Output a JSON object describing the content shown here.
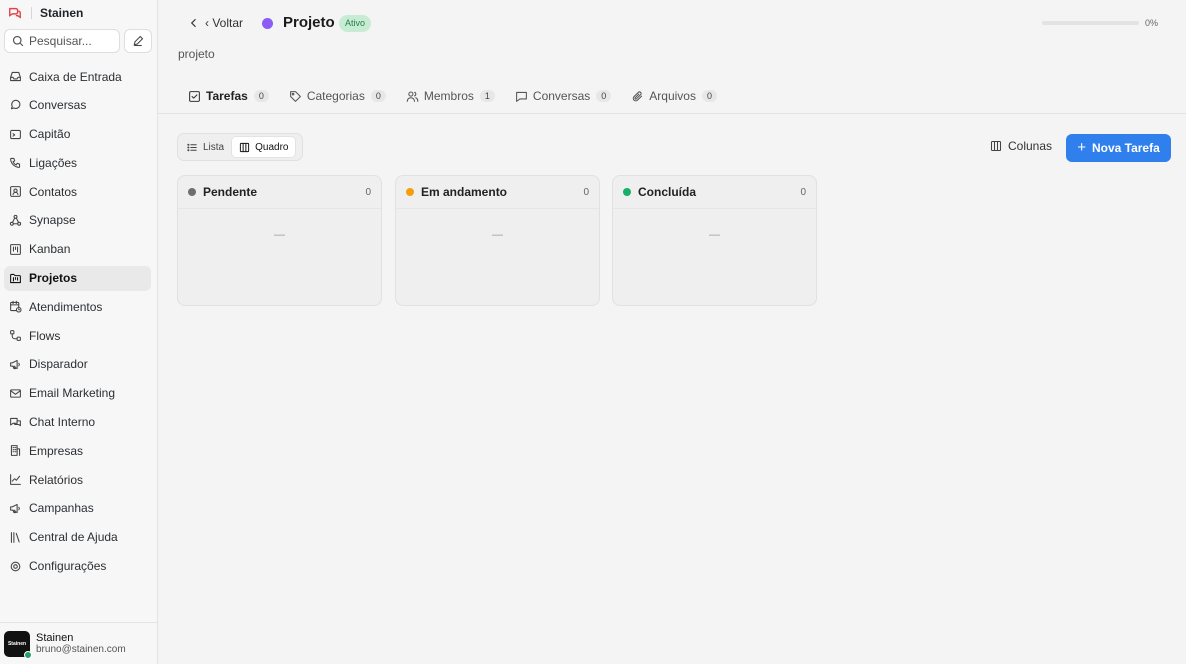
{
  "brand": {
    "name": "Stainen"
  },
  "search": {
    "placeholder": "Pesquisar..."
  },
  "sidebar": {
    "items": [
      {
        "label": "Caixa de Entrada",
        "icon": "inbox-icon"
      },
      {
        "label": "Conversas",
        "icon": "chat-bubble-icon"
      },
      {
        "label": "Capitão",
        "icon": "terminal-icon"
      },
      {
        "label": "Ligações",
        "icon": "phone-icon"
      },
      {
        "label": "Contatos",
        "icon": "contact-card-icon"
      },
      {
        "label": "Synapse",
        "icon": "network-icon"
      },
      {
        "label": "Kanban",
        "icon": "kanban-icon"
      },
      {
        "label": "Projetos",
        "icon": "folder-kanban-icon",
        "active": true
      },
      {
        "label": "Atendimentos",
        "icon": "calendar-clock-icon"
      },
      {
        "label": "Flows",
        "icon": "flow-icon"
      },
      {
        "label": "Disparador",
        "icon": "megaphone-icon"
      },
      {
        "label": "Email Marketing",
        "icon": "mail-icon"
      },
      {
        "label": "Chat Interno",
        "icon": "messages-icon"
      },
      {
        "label": "Empresas",
        "icon": "building-icon"
      },
      {
        "label": "Relatórios",
        "icon": "chart-line-icon"
      },
      {
        "label": "Campanhas",
        "icon": "megaphone-icon"
      },
      {
        "label": "Central de Ajuda",
        "icon": "library-icon"
      },
      {
        "label": "Configurações",
        "icon": "settings-icon"
      }
    ]
  },
  "user": {
    "name": "Stainen",
    "email": "bruno@stainen.com",
    "avatar_text": "Stainen"
  },
  "header": {
    "back_label": "‹ Voltar",
    "title": "Projeto",
    "status": "Ativo",
    "progress_text": "0%",
    "progress": 0,
    "description": "projeto",
    "project_color": "#8b5cf6"
  },
  "tabs": [
    {
      "label": "Tarefas",
      "count": "0",
      "icon": "check-square-icon"
    },
    {
      "label": "Categorias",
      "count": "0",
      "icon": "tag-icon"
    },
    {
      "label": "Membros",
      "count": "1",
      "icon": "users-icon"
    },
    {
      "label": "Conversas",
      "count": "0",
      "icon": "message-square-icon"
    },
    {
      "label": "Arquivos",
      "count": "0",
      "icon": "paperclip-icon"
    }
  ],
  "view_toggle": {
    "list_label": "Lista",
    "board_label": "Quadro"
  },
  "toolbar": {
    "columns_label": "Colunas",
    "new_task_label": "Nova Tarefa"
  },
  "columns": [
    {
      "title": "Pendente",
      "count": "0",
      "color": "#6b6f75",
      "empty": "—"
    },
    {
      "title": "Em andamento",
      "count": "0",
      "color": "#f59e0b",
      "empty": "—"
    },
    {
      "title": "Concluída",
      "count": "0",
      "color": "#16b068",
      "empty": "—"
    }
  ]
}
